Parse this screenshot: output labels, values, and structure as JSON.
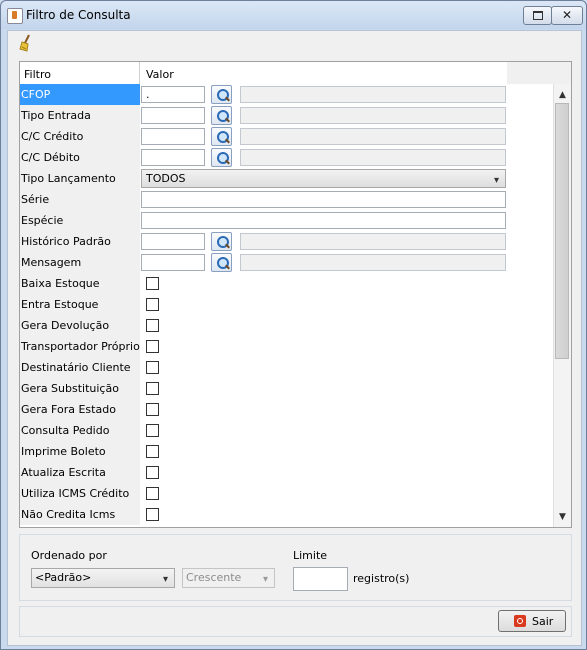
{
  "window": {
    "title": "Filtro de Consulta"
  },
  "grid": {
    "header": {
      "col1": "Filtro",
      "col2": "Valor"
    },
    "rows": [
      {
        "label": "CFOP",
        "kind": "lookup",
        "value": ".",
        "selected": true
      },
      {
        "label": "Tipo Entrada",
        "kind": "lookup",
        "value": ""
      },
      {
        "label": "C/C Crédito",
        "kind": "lookup",
        "value": ""
      },
      {
        "label": "C/C Débito",
        "kind": "lookup",
        "value": ""
      },
      {
        "label": "Tipo Lançamento",
        "kind": "combo",
        "value": "TODOS"
      },
      {
        "label": "Série",
        "kind": "text",
        "value": ""
      },
      {
        "label": "Espécie",
        "kind": "text",
        "value": ""
      },
      {
        "label": "Histórico Padrão",
        "kind": "lookup",
        "value": ""
      },
      {
        "label": "Mensagem",
        "kind": "lookup",
        "value": ""
      },
      {
        "label": "Baixa Estoque",
        "kind": "check",
        "checked": false
      },
      {
        "label": "Entra Estoque",
        "kind": "check",
        "checked": false
      },
      {
        "label": "Gera Devolução",
        "kind": "check",
        "checked": false
      },
      {
        "label": "Transportador Próprio",
        "kind": "check",
        "checked": false
      },
      {
        "label": "Destinatário Cliente",
        "kind": "check",
        "checked": false
      },
      {
        "label": "Gera Substituição",
        "kind": "check",
        "checked": false
      },
      {
        "label": "Gera Fora Estado",
        "kind": "check",
        "checked": false
      },
      {
        "label": "Consulta Pedido",
        "kind": "check",
        "checked": false
      },
      {
        "label": "Imprime Boleto",
        "kind": "check",
        "checked": false
      },
      {
        "label": "Atualiza Escrita",
        "kind": "check",
        "checked": false
      },
      {
        "label": "Utiliza ICMS Crédito",
        "kind": "check",
        "checked": false
      },
      {
        "label": "Não Credita Icms",
        "kind": "check",
        "checked": false
      }
    ]
  },
  "order": {
    "label": "Ordenado por",
    "selected": "<Padrão>",
    "direction": "Crescente",
    "limit_label": "Limite",
    "limit_value": "",
    "limit_suffix": "registro(s)"
  },
  "buttons": {
    "exit_label": "Sair"
  },
  "colors": {
    "selection": "#3399ff",
    "title_bar": "#c9d9ee"
  }
}
